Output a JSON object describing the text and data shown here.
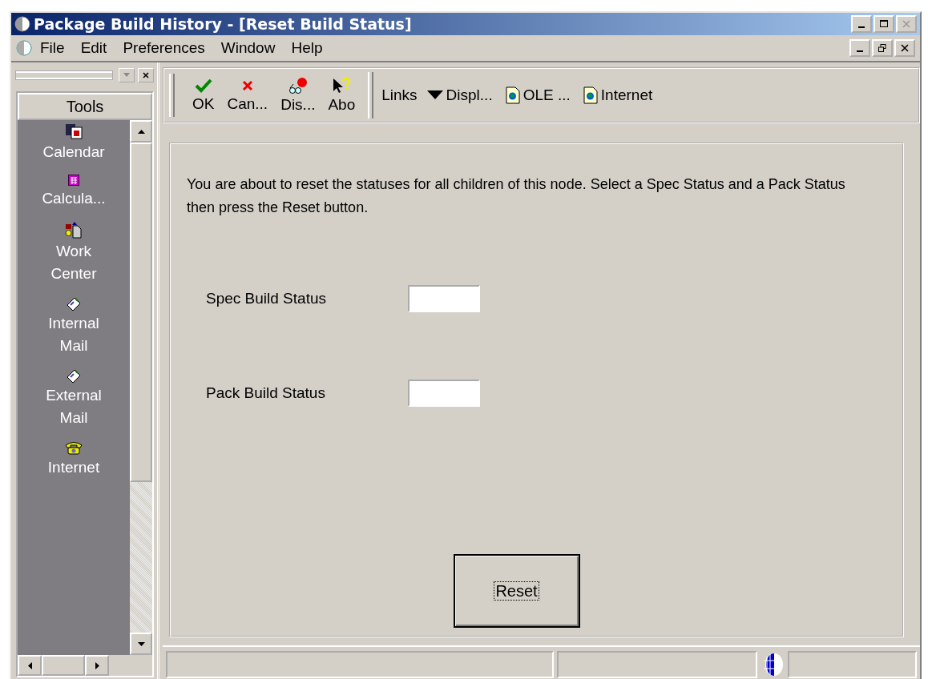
{
  "window": {
    "title": "Package Build History - [Reset Build Status]"
  },
  "menu": [
    "File",
    "Edit",
    "Preferences",
    "Window",
    "Help"
  ],
  "tools_panel": {
    "title": "Tools",
    "items": [
      {
        "label": "Calendar",
        "kind": "calendar"
      },
      {
        "label": "Calcula...",
        "kind": "calculator"
      },
      {
        "label": "Work Center",
        "kind": "workcenter"
      },
      {
        "label": "Internal Mail",
        "kind": "mail"
      },
      {
        "label": "External Mail",
        "kind": "mail"
      },
      {
        "label": "Internet",
        "kind": "phone"
      }
    ]
  },
  "toolbar": {
    "buttons": [
      {
        "label": "OK",
        "kind": "ok"
      },
      {
        "label": "Can...",
        "kind": "cancel"
      },
      {
        "label": "Dis...",
        "kind": "display"
      },
      {
        "label": "Abo",
        "kind": "about"
      }
    ],
    "links_label": "Links",
    "links": [
      {
        "label": "Displ...",
        "kind": "dropdown"
      },
      {
        "label": "OLE ...",
        "kind": "document"
      },
      {
        "label": "Internet",
        "kind": "document"
      }
    ]
  },
  "form": {
    "instructions": "You are about to reset the statuses for all children of this node.  Select a Spec Status and a Pack Status then press the Reset button.",
    "fields": [
      {
        "label": "Spec Build Status"
      },
      {
        "label": "Pack Build Status"
      }
    ],
    "reset_button": "Reset"
  }
}
